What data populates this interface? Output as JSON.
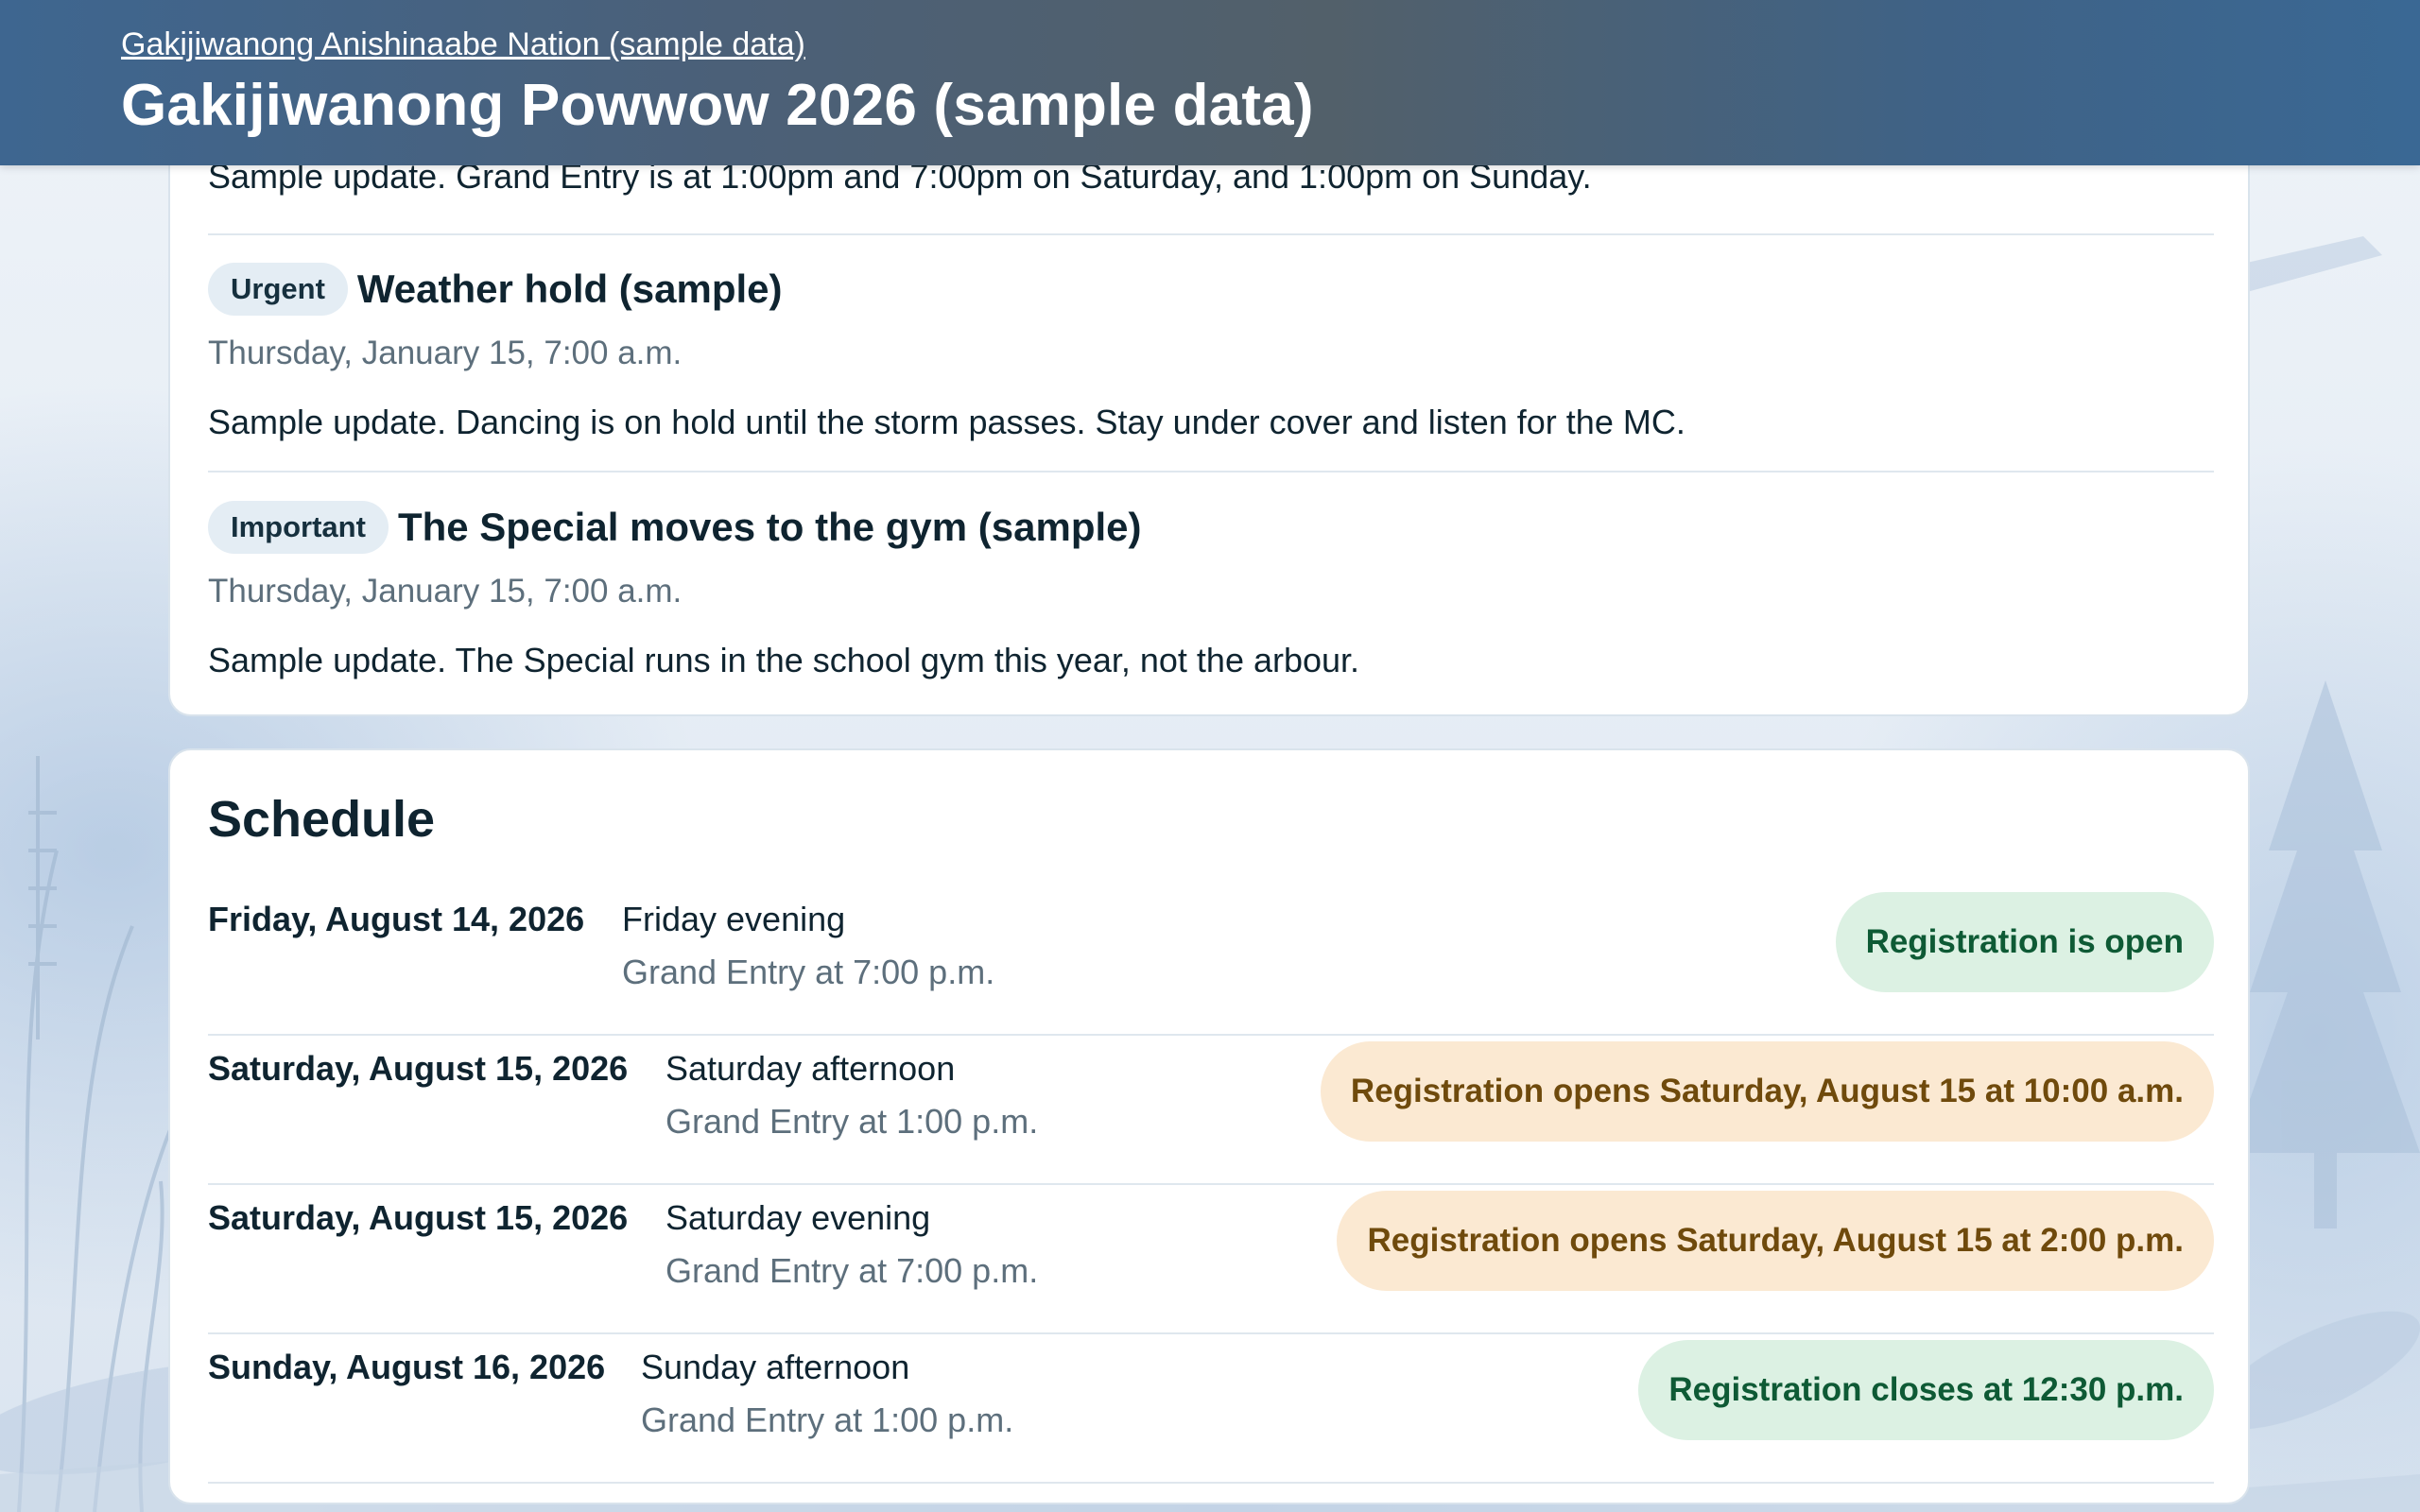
{
  "header": {
    "org_link": "Gakijiwanong Anishinaabe Nation (sample data)",
    "title": "Gakijiwanong Powwow 2026 (sample data)"
  },
  "updates": {
    "partial_text": "Sample update. Grand Entry is at 1:00pm and 7:00pm on Saturday, and 1:00pm on Sunday.",
    "items": [
      {
        "badge": "Urgent",
        "title": "Weather hold (sample)",
        "date": "Thursday, January 15, 7:00 a.m.",
        "body": "Sample update. Dancing is on hold until the storm passes. Stay under cover and listen for the MC."
      },
      {
        "badge": "Important",
        "title": "The Special moves to the gym (sample)",
        "date": "Thursday, January 15, 7:00 a.m.",
        "body": "Sample update. The Special runs in the school gym this year, not the arbour."
      }
    ]
  },
  "schedule": {
    "heading": "Schedule",
    "rows": [
      {
        "date": "Friday, August 14, 2026",
        "session": "Friday evening",
        "grand_entry": "Grand Entry at 7:00 p.m.",
        "status": "Registration is open",
        "status_kind": "open"
      },
      {
        "date": "Saturday, August 15, 2026",
        "session": "Saturday afternoon",
        "grand_entry": "Grand Entry at 1:00 p.m.",
        "status": "Registration opens Saturday, August 15 at 10:00 a.m.",
        "status_kind": "upcoming"
      },
      {
        "date": "Saturday, August 15, 2026",
        "session": "Saturday evening",
        "grand_entry": "Grand Entry at 7:00 p.m.",
        "status": "Registration opens Saturday, August 15 at 2:00 p.m.",
        "status_kind": "upcoming"
      },
      {
        "date": "Sunday, August 16, 2026",
        "session": "Sunday afternoon",
        "grand_entry": "Grand Entry at 1:00 p.m.",
        "status": "Registration closes at 12:30 p.m.",
        "status_kind": "open"
      }
    ]
  },
  "colors": {
    "status_open_bg": "#dcf1e3",
    "status_open_text": "#0e5a35",
    "status_upcoming_bg": "#fbe9d2",
    "status_upcoming_text": "#6f4a0c",
    "header_bg": "#4b6078"
  }
}
